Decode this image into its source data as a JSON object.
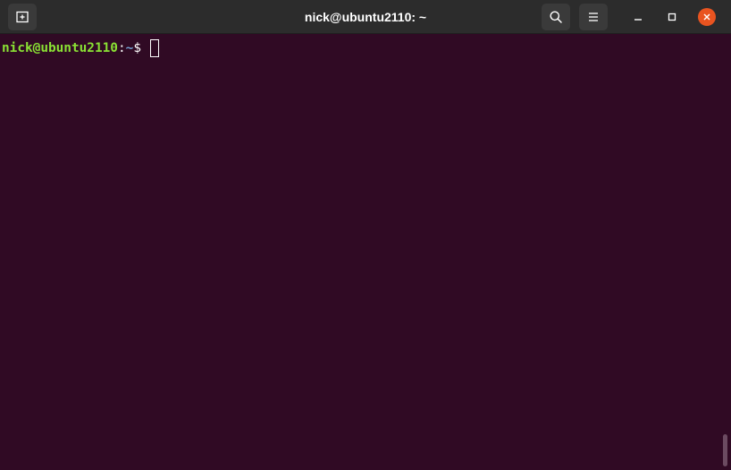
{
  "window": {
    "title": "nick@ubuntu2110: ~"
  },
  "titlebar": {
    "new_tab_icon": "new-tab-icon",
    "search_icon": "search-icon",
    "menu_icon": "hamburger-menu-icon",
    "minimize_icon": "minimize-icon",
    "maximize_icon": "maximize-icon",
    "close_icon": "close-icon"
  },
  "terminal": {
    "prompt_user_host": "nick@ubuntu2110",
    "prompt_colon": ":",
    "prompt_path": "~",
    "prompt_symbol": "$ ",
    "input": ""
  },
  "colors": {
    "background": "#300a24",
    "titlebar": "#2c2c2c",
    "prompt_user_host": "#8ae234",
    "prompt_path": "#729fcf",
    "close_button": "#e95420"
  }
}
